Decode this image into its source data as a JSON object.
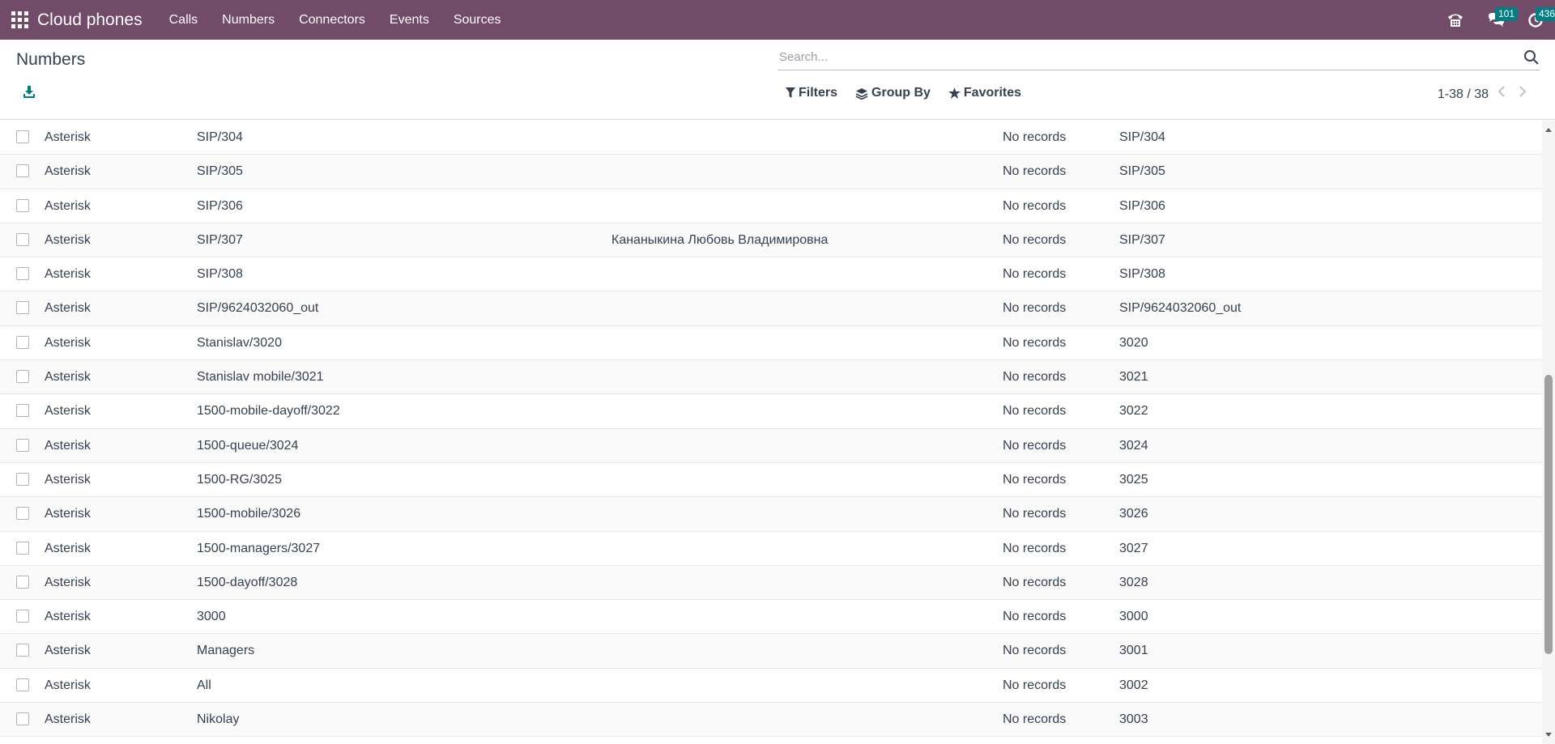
{
  "navbar": {
    "brand": "Cloud phones",
    "menu": [
      "Calls",
      "Numbers",
      "Connectors",
      "Events",
      "Sources"
    ],
    "messages_count": "101",
    "activities_count": "436",
    "bg_color": "#714b67"
  },
  "control": {
    "title": "Numbers",
    "search_placeholder": "Search...",
    "filters_label": "Filters",
    "groupby_label": "Group By",
    "favorites_label": "Favorites",
    "pager": "1-38 / 38"
  },
  "rows": [
    {
      "connector": "Asterisk",
      "name": "SIP/304",
      "user": "",
      "records": "No records",
      "number": "SIP/304"
    },
    {
      "connector": "Asterisk",
      "name": "SIP/305",
      "user": "",
      "records": "No records",
      "number": "SIP/305"
    },
    {
      "connector": "Asterisk",
      "name": "SIP/306",
      "user": "",
      "records": "No records",
      "number": "SIP/306"
    },
    {
      "connector": "Asterisk",
      "name": "SIP/307",
      "user": "Кананыкина Любовь Владимировна",
      "records": "No records",
      "number": "SIP/307"
    },
    {
      "connector": "Asterisk",
      "name": "SIP/308",
      "user": "",
      "records": "No records",
      "number": "SIP/308"
    },
    {
      "connector": "Asterisk",
      "name": "SIP/9624032060_out",
      "user": "",
      "records": "No records",
      "number": "SIP/9624032060_out"
    },
    {
      "connector": "Asterisk",
      "name": "Stanislav/3020",
      "user": "",
      "records": "No records",
      "number": "3020"
    },
    {
      "connector": "Asterisk",
      "name": "Stanislav mobile/3021",
      "user": "",
      "records": "No records",
      "number": "3021"
    },
    {
      "connector": "Asterisk",
      "name": "1500-mobile-dayoff/3022",
      "user": "",
      "records": "No records",
      "number": "3022"
    },
    {
      "connector": "Asterisk",
      "name": "1500-queue/3024",
      "user": "",
      "records": "No records",
      "number": "3024"
    },
    {
      "connector": "Asterisk",
      "name": "1500-RG/3025",
      "user": "",
      "records": "No records",
      "number": "3025"
    },
    {
      "connector": "Asterisk",
      "name": "1500-mobile/3026",
      "user": "",
      "records": "No records",
      "number": "3026"
    },
    {
      "connector": "Asterisk",
      "name": "1500-managers/3027",
      "user": "",
      "records": "No records",
      "number": "3027"
    },
    {
      "connector": "Asterisk",
      "name": "1500-dayoff/3028",
      "user": "",
      "records": "No records",
      "number": "3028"
    },
    {
      "connector": "Asterisk",
      "name": "3000",
      "user": "",
      "records": "No records",
      "number": "3000"
    },
    {
      "connector": "Asterisk",
      "name": "Managers",
      "user": "",
      "records": "No records",
      "number": "3001"
    },
    {
      "connector": "Asterisk",
      "name": "All",
      "user": "",
      "records": "No records",
      "number": "3002"
    },
    {
      "connector": "Asterisk",
      "name": "Nikolay",
      "user": "",
      "records": "No records",
      "number": "3003"
    }
  ]
}
